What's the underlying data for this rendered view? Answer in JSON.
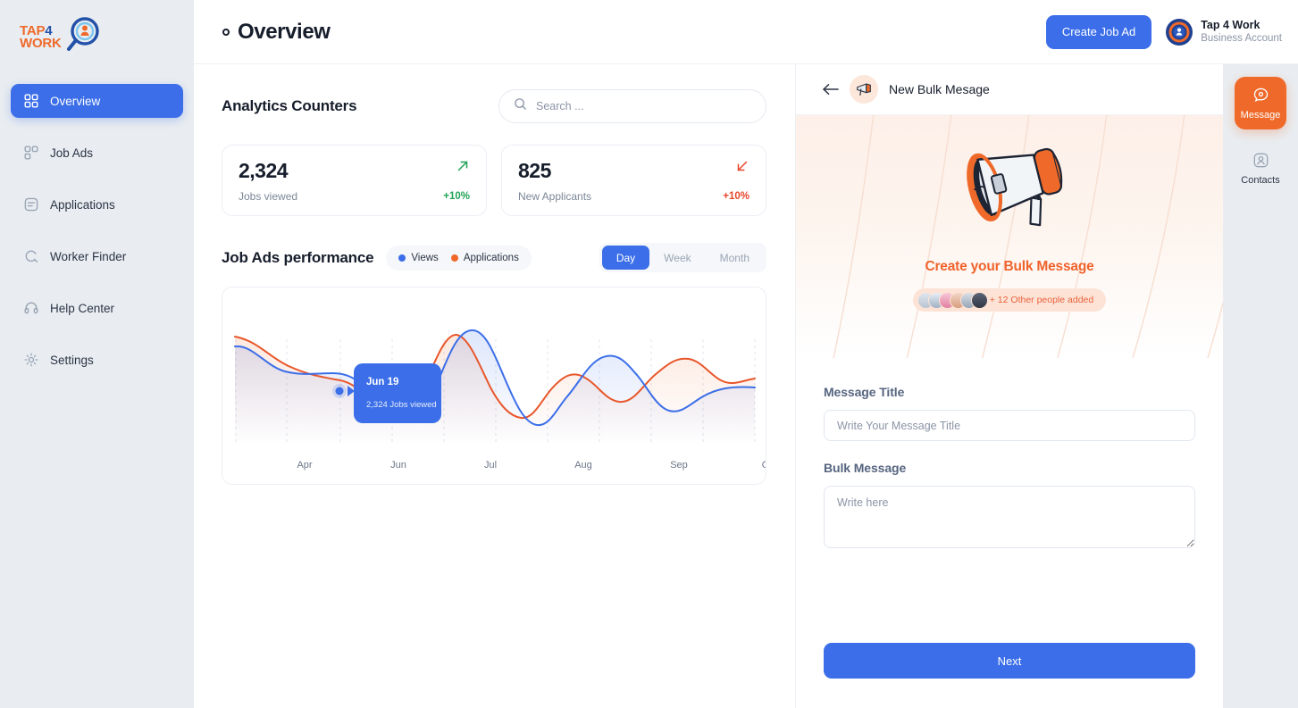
{
  "brand": {
    "logo_line1": "TAP",
    "logo_four": "4",
    "logo_line2": "WORK",
    "accent_blue": "#3b6ee8",
    "accent_orange": "#ef6a2a"
  },
  "sidebar": {
    "items": [
      {
        "label": "Overview",
        "icon": "grid-icon",
        "active": true
      },
      {
        "label": "Job Ads",
        "icon": "job-ads-icon",
        "active": false
      },
      {
        "label": "Applications",
        "icon": "document-icon",
        "active": false
      },
      {
        "label": "Worker Finder",
        "icon": "search-person-icon",
        "active": false
      },
      {
        "label": "Help Center",
        "icon": "headset-icon",
        "active": false
      },
      {
        "label": "Settings",
        "icon": "gear-icon",
        "active": false
      }
    ]
  },
  "topbar": {
    "title": "Overview",
    "create_job_ad": "Create Job Ad",
    "account_name": "Tap 4 Work",
    "account_type": "Business Account"
  },
  "analytics": {
    "section_title": "Analytics Counters",
    "search_placeholder": "Search ...",
    "search_value": "",
    "cards": [
      {
        "value": "2,324",
        "label": "Jobs viewed",
        "change": "+10%",
        "direction": "up",
        "color": "#22a356"
      },
      {
        "value": "825",
        "label": "New Applicants",
        "change": "+10%",
        "direction": "down",
        "color": "#e8462c"
      }
    ]
  },
  "performance": {
    "title": "Job Ads performance",
    "legend": [
      {
        "label": "Views",
        "color": "#3b6ee8"
      },
      {
        "label": "Applications",
        "color": "#ef6a2a"
      }
    ],
    "ranges": [
      {
        "label": "Day",
        "active": true
      },
      {
        "label": "Week",
        "active": false
      },
      {
        "label": "Month",
        "active": false
      }
    ],
    "tooltip": {
      "date": "Jun 19",
      "detail": "2,324 Jobs viewed"
    }
  },
  "chart_data": {
    "type": "line",
    "title": "Job Ads performance",
    "xlabel": "",
    "ylabel": "",
    "grid": true,
    "legend_position": "top-left",
    "tick_labels": [
      "Apr",
      "Jun",
      "Jul",
      "Aug",
      "Sep",
      "O"
    ],
    "series": [
      {
        "name": "Views",
        "color": "#3b6ee8",
        "values": [
          72,
          62,
          55,
          56,
          55,
          48,
          30,
          34,
          50,
          88,
          97,
          72,
          38,
          24,
          26,
          45,
          70,
          82,
          70,
          42,
          34,
          44,
          56
        ]
      },
      {
        "name": "Applications",
        "color": "#ef6a2a",
        "values": [
          80,
          74,
          62,
          50,
          44,
          42,
          36,
          28,
          30,
          62,
          86,
          80,
          55,
          42,
          42,
          56,
          66,
          62,
          52,
          50,
          62,
          68,
          52,
          57
        ]
      }
    ],
    "highlight_point": {
      "series": "Views",
      "label": "Jun 19",
      "value": "2,324 Jobs viewed"
    }
  },
  "message_panel": {
    "header_title": "New  Bulk Mesage",
    "hero_title": "Create your Bulk Message",
    "people_pill": "+ 12 Other people added",
    "fields": [
      {
        "label": "Message Title",
        "placeholder": "Write Your Message Title",
        "value": "",
        "type": "input"
      },
      {
        "label": "Bulk Message",
        "placeholder": "Write here",
        "value": "",
        "type": "textarea"
      }
    ],
    "next_label": "Next"
  },
  "right_rail": {
    "items": [
      {
        "label": "Message",
        "icon": "chat-bubble-icon",
        "active": true
      },
      {
        "label": "Contacts",
        "icon": "contact-icon",
        "active": false
      }
    ]
  }
}
